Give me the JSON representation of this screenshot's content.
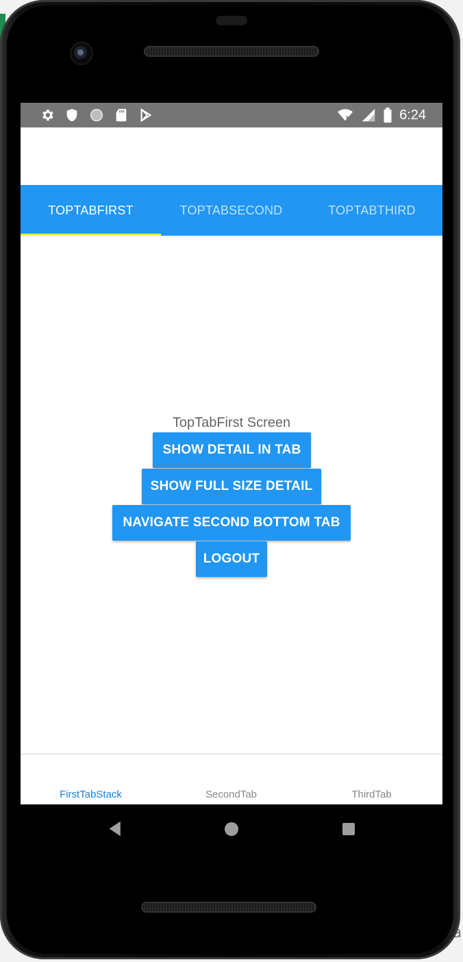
{
  "status_bar": {
    "time": "6:24",
    "left_icons": [
      "settings-icon",
      "shield-icon",
      "circle-icon",
      "sd-card-icon",
      "play-store-icon"
    ],
    "right_icons": [
      "wifi-icon",
      "cell-signal-icon",
      "battery-icon"
    ]
  },
  "top_tabs": [
    {
      "label": "TOPTABFIRST",
      "active": true
    },
    {
      "label": "TOPTABSECOND",
      "active": false
    },
    {
      "label": "TOPTABTHIRD",
      "active": false
    }
  ],
  "content": {
    "screen_label": "TopTabFirst Screen",
    "buttons": {
      "show_detail": "SHOW DETAIL IN TAB",
      "show_full": "SHOW FULL SIZE DETAIL",
      "navigate_second": "NAVIGATE SECOND BOTTOM TAB",
      "logout": "LOGOUT"
    }
  },
  "bottom_tabs": [
    {
      "label": "FirstTabStack",
      "active": true
    },
    {
      "label": "SecondTab",
      "active": false
    },
    {
      "label": "ThirdTab",
      "active": false
    }
  ],
  "nav_bar": {
    "icons": [
      "back-icon",
      "home-icon",
      "recents-icon"
    ]
  },
  "colors": {
    "accent": "#2196f3",
    "tab_indicator": "#ffeb3b",
    "status_bar": "#757575",
    "active_bottom_tab": "#1a7fe0"
  },
  "background": {
    "corner_text": "tta"
  }
}
